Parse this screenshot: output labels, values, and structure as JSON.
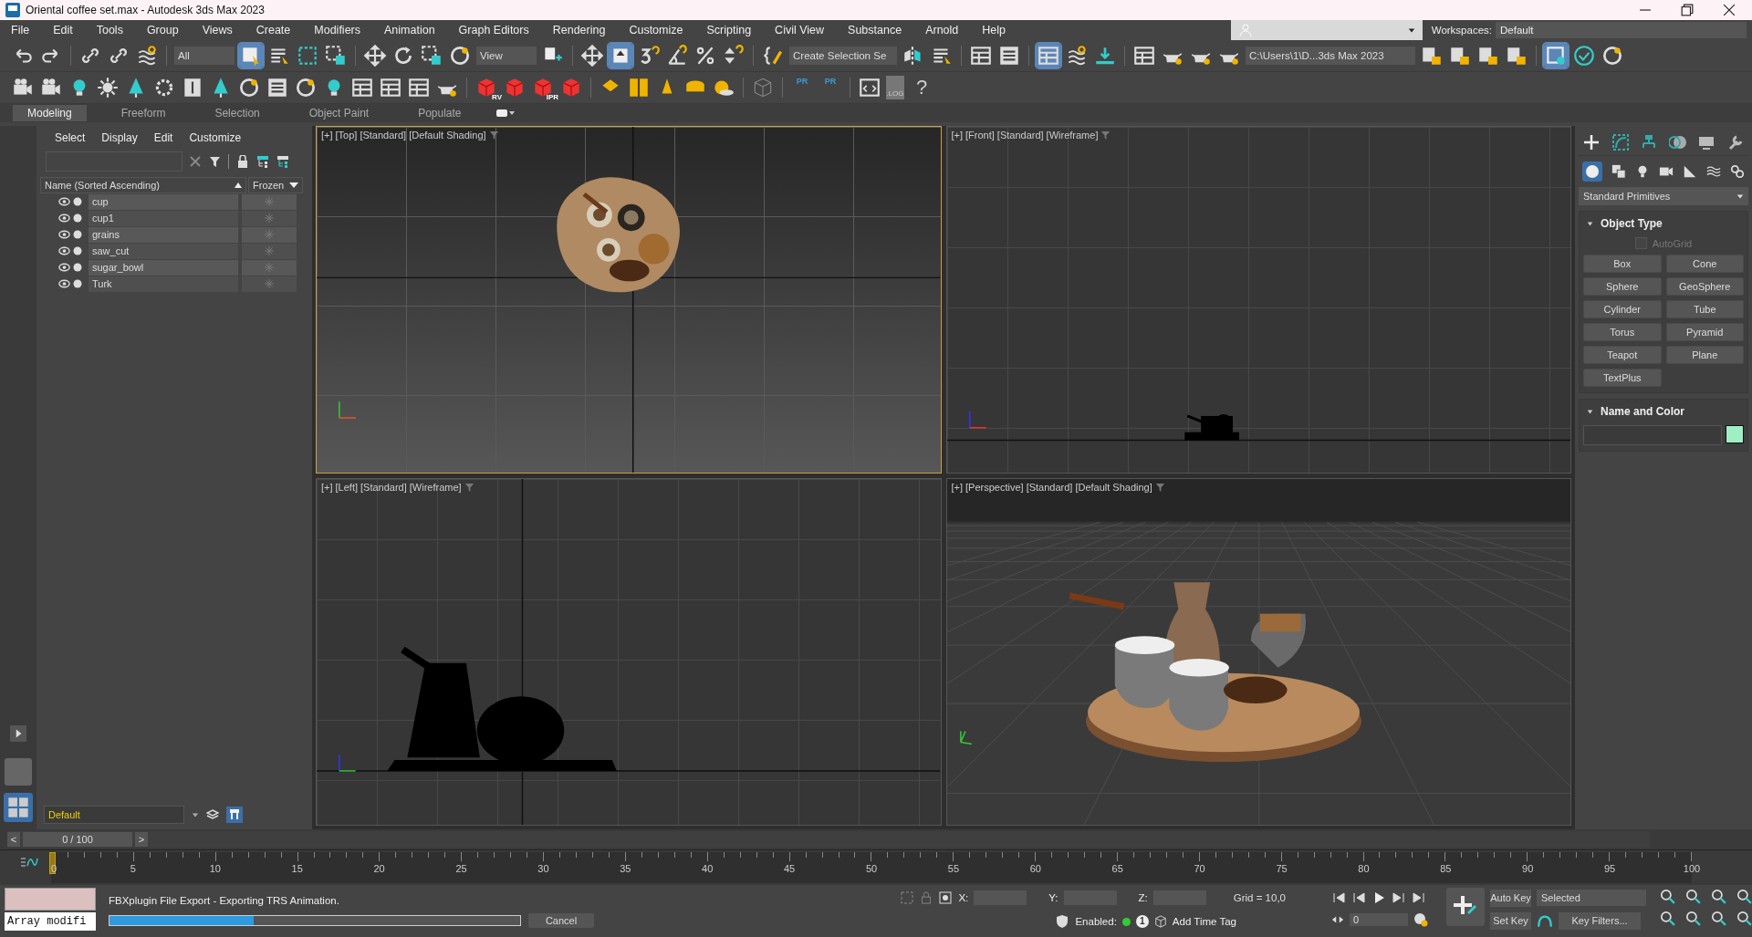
{
  "window": {
    "title": "Oriental coffee set.max - Autodesk 3ds Max 2023"
  },
  "menu": [
    "File",
    "Edit",
    "Tools",
    "Group",
    "Views",
    "Create",
    "Modifiers",
    "Animation",
    "Graph Editors",
    "Rendering",
    "Customize",
    "Scripting",
    "Civil View",
    "Substance",
    "Arnold",
    "Help"
  ],
  "workspaces": {
    "label": "Workspaces:",
    "value": "Default"
  },
  "toolbar": {
    "selection_filter": "All",
    "reference_coord": "View",
    "named_selection": "Create Selection Se",
    "project_path": "C:\\Users\\1\\D...3ds Max 2023"
  },
  "toolbar2_labels": {
    "render_badges": [
      "RV",
      "IPR"
    ],
    "pr": [
      "PR",
      "PR"
    ],
    "log": ".LOG",
    "help": "?"
  },
  "ribbon_tabs": [
    {
      "label": "Modeling",
      "selected": true
    },
    {
      "label": "Freeform",
      "selected": false
    },
    {
      "label": "Selection",
      "selected": false
    },
    {
      "label": "Object Paint",
      "selected": false
    },
    {
      "label": "Populate",
      "selected": false
    }
  ],
  "scene_explorer": {
    "menu": [
      "Select",
      "Display",
      "Edit",
      "Customize"
    ],
    "columns": [
      "Name (Sorted Ascending)",
      "Frozen"
    ],
    "objects": [
      {
        "name": "cup"
      },
      {
        "name": "cup1"
      },
      {
        "name": "grains"
      },
      {
        "name": "saw_cut"
      },
      {
        "name": "sugar_bowl"
      },
      {
        "name": "Turk"
      }
    ],
    "layer": "Default"
  },
  "viewports": [
    {
      "kind": "top",
      "active": true,
      "labels": [
        "[+]",
        "[Top]",
        "[Standard]",
        "[Default Shading]"
      ]
    },
    {
      "kind": "front",
      "active": false,
      "labels": [
        "[+]",
        "[Front]",
        "[Standard]",
        "[Wireframe]"
      ]
    },
    {
      "kind": "left",
      "active": false,
      "labels": [
        "[+]",
        "[Left]",
        "[Standard]",
        "[Wireframe]"
      ]
    },
    {
      "kind": "perspective",
      "active": false,
      "labels": [
        "[+]",
        "[Perspective]",
        "[Standard]",
        "[Default Shading]"
      ]
    }
  ],
  "command_panel": {
    "category": "Standard Primitives",
    "object_type": {
      "title": "Object Type",
      "autogrid": {
        "label": "AutoGrid",
        "checked": false,
        "disabled": true
      },
      "buttons": [
        "Box",
        "Cone",
        "Sphere",
        "GeoSphere",
        "Cylinder",
        "Tube",
        "Torus",
        "Pyramid",
        "Teapot",
        "Plane",
        "TextPlus"
      ]
    },
    "name_and_color": {
      "title": "Name and Color",
      "color": "#9ef0c4"
    }
  },
  "time_slider": {
    "prev": "<",
    "label": "0 / 100",
    "next": ">",
    "level": 0
  },
  "timeline": {
    "ticks": [
      "0",
      "5",
      "10",
      "15",
      "20",
      "25",
      "30",
      "35",
      "40",
      "45",
      "50",
      "55",
      "60",
      "65",
      "70",
      "75",
      "80",
      "85",
      "90",
      "95",
      "100"
    ]
  },
  "status": {
    "listener": "Array modifi",
    "prompt": "FBXplugin File Export  -  Exporting TRS Animation.",
    "progress": {
      "level": 0.35
    },
    "cancel": "Cancel"
  },
  "coords": {
    "x": "X:",
    "y": "Y:",
    "z": "Z:",
    "grid": "Grid = 10,0"
  },
  "time_tag": {
    "enabled_label": "Enabled:",
    "enabled": true,
    "badge": "1",
    "add": "Add Time Tag"
  },
  "animation": {
    "frame": "0",
    "auto_key": "Auto Key",
    "set_key": "Set Key",
    "key_mode": "Selected",
    "key_filters": "Key Filters..."
  }
}
